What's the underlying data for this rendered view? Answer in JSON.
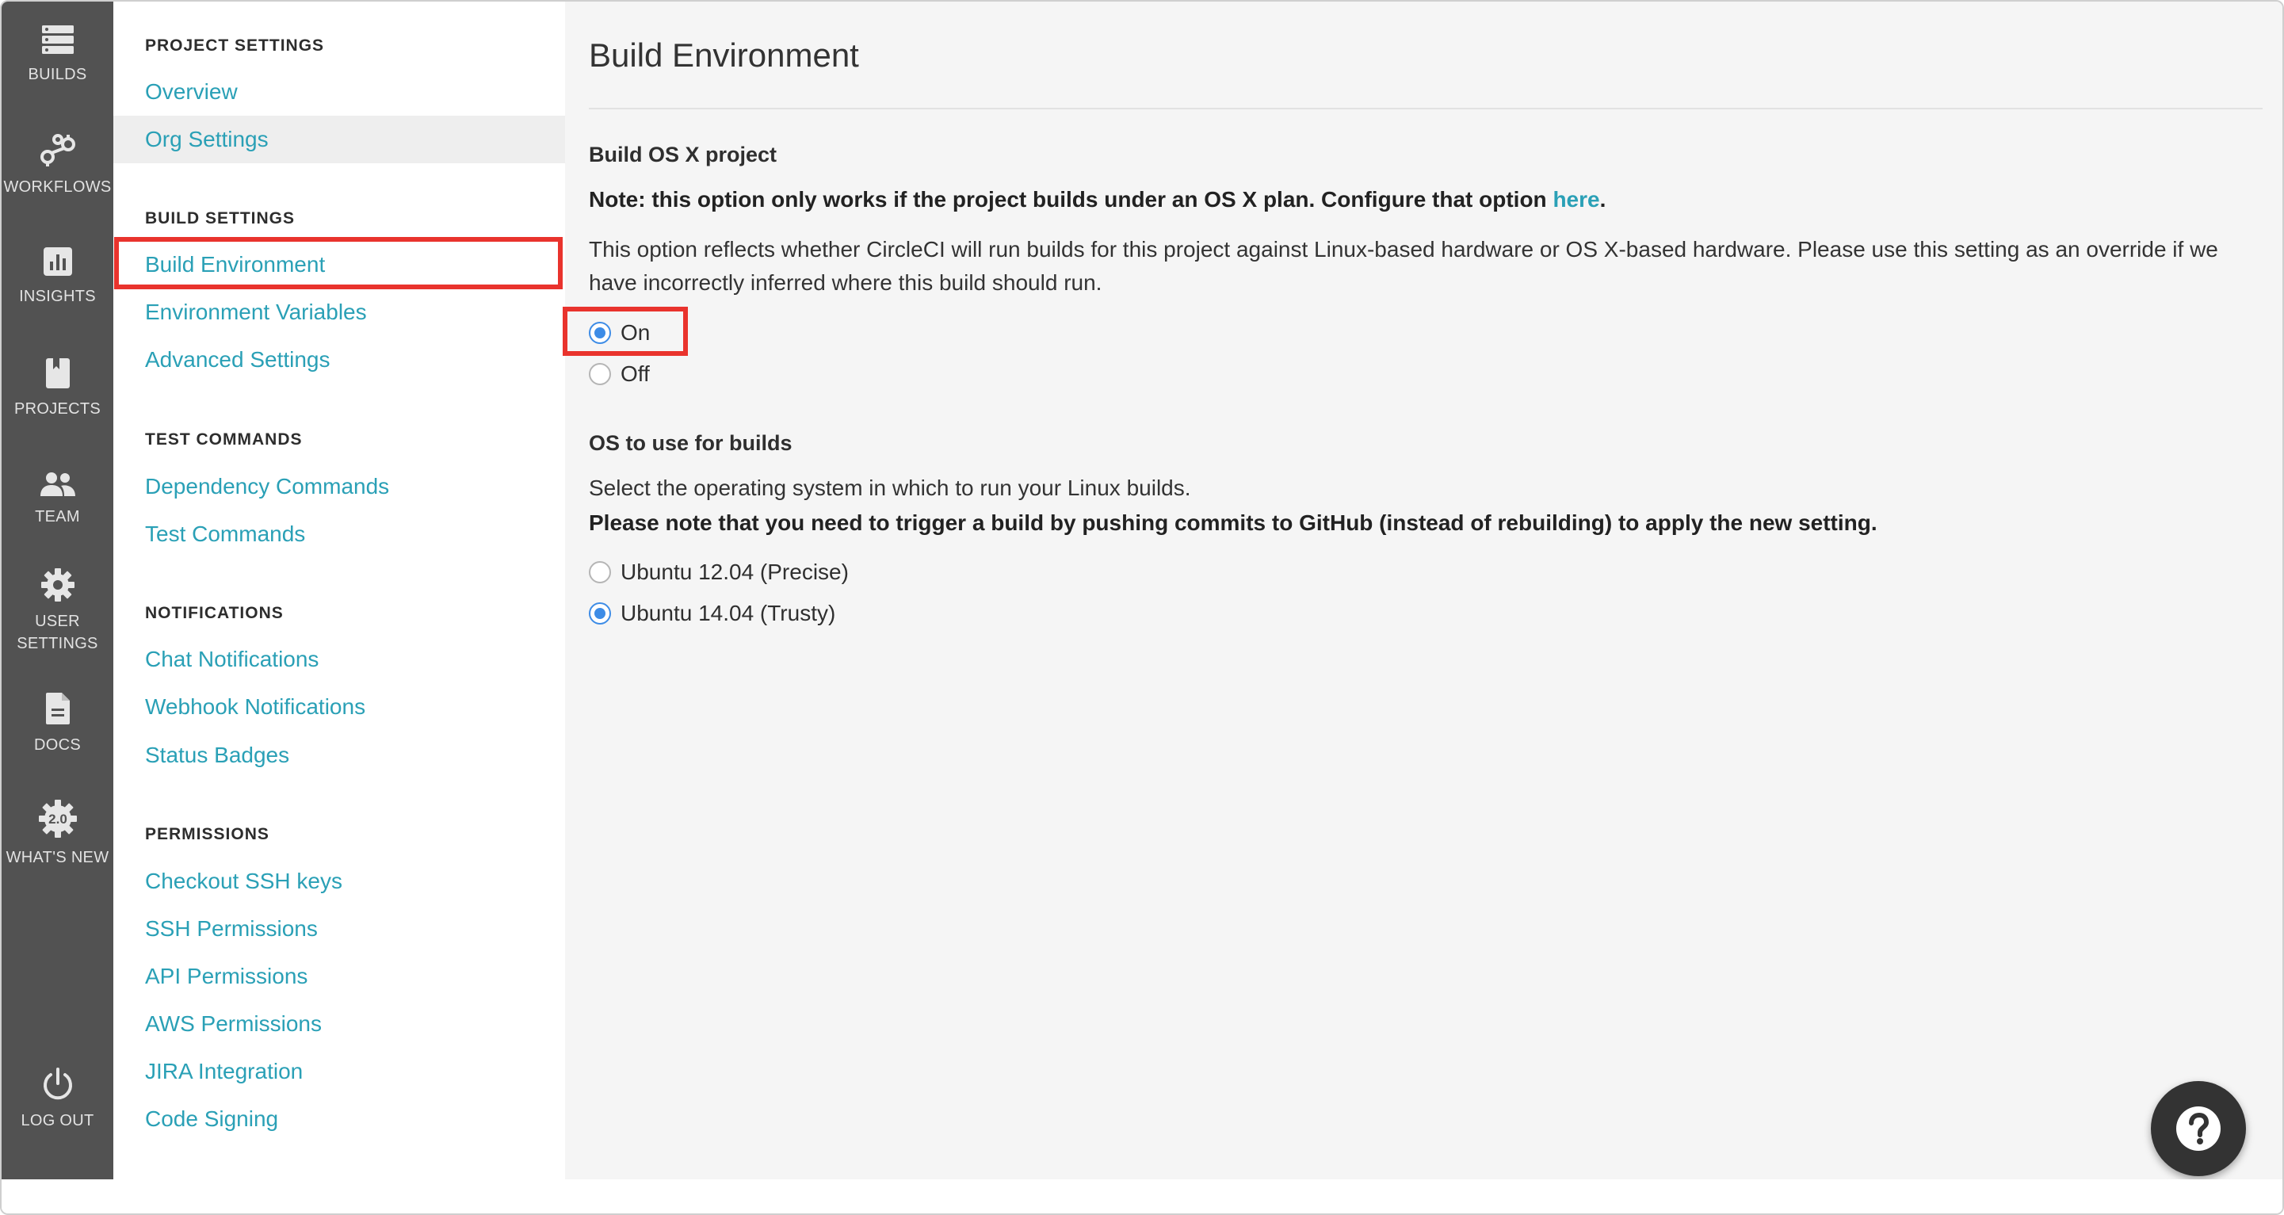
{
  "nav": {
    "items": [
      {
        "label": "BUILDS",
        "icon": "builds-icon"
      },
      {
        "label": "WORKFLOWS",
        "icon": "workflows-icon"
      },
      {
        "label": "INSIGHTS",
        "icon": "insights-icon"
      },
      {
        "label": "PROJECTS",
        "icon": "projects-icon"
      },
      {
        "label": "TEAM",
        "icon": "team-icon"
      },
      {
        "label": "USER SETTINGS",
        "icon": "gear-icon"
      },
      {
        "label": "DOCS",
        "icon": "docs-icon"
      },
      {
        "label": "WHAT'S NEW",
        "icon": "whats-new-icon",
        "badge": "2.0"
      }
    ],
    "logout": {
      "label": "LOG OUT",
      "icon": "power-icon"
    }
  },
  "sidebar": {
    "project_settings": {
      "heading": "PROJECT SETTINGS",
      "links": [
        "Overview",
        "Org Settings"
      ]
    },
    "build_settings": {
      "heading": "BUILD SETTINGS",
      "links": [
        "Build Environment",
        "Environment Variables",
        "Advanced Settings"
      ]
    },
    "test_commands": {
      "heading": "TEST COMMANDS",
      "links": [
        "Dependency Commands",
        "Test Commands"
      ]
    },
    "notifications": {
      "heading": "NOTIFICATIONS",
      "links": [
        "Chat Notifications",
        "Webhook Notifications",
        "Status Badges"
      ]
    },
    "permissions": {
      "heading": "PERMISSIONS",
      "links": [
        "Checkout SSH keys",
        "SSH Permissions",
        "API Permissions",
        "AWS Permissions",
        "JIRA Integration",
        "Code Signing"
      ]
    }
  },
  "main": {
    "title": "Build Environment",
    "osx": {
      "heading": "Build OS X project",
      "note_prefix": "Note: this option only works if the project builds under an OS X plan. Configure that option ",
      "note_link": "here",
      "note_suffix": ".",
      "description": "This option reflects whether CircleCI will run builds for this project against Linux-based hardware or OS X-based hardware. Please use this setting as an override if we have incorrectly inferred where this build should run.",
      "options": [
        {
          "label": "On",
          "checked": true
        },
        {
          "label": "Off",
          "checked": false
        }
      ]
    },
    "os": {
      "heading": "OS to use for builds",
      "description": "Select the operating system in which to run your Linux builds.",
      "warning": "Please note that you need to trigger a build by pushing commits to GitHub (instead of rebuilding) to apply the new setting.",
      "options": [
        {
          "label": "Ubuntu 12.04 (Precise)",
          "checked": false
        },
        {
          "label": "Ubuntu 14.04 (Trusty)",
          "checked": true
        }
      ]
    }
  },
  "help_button": {
    "icon": "question-icon"
  },
  "colors": {
    "nav_bg": "#525252",
    "link": "#2aa0b6",
    "radio_accent": "#3d8ce6",
    "highlight": "#e9332d"
  }
}
